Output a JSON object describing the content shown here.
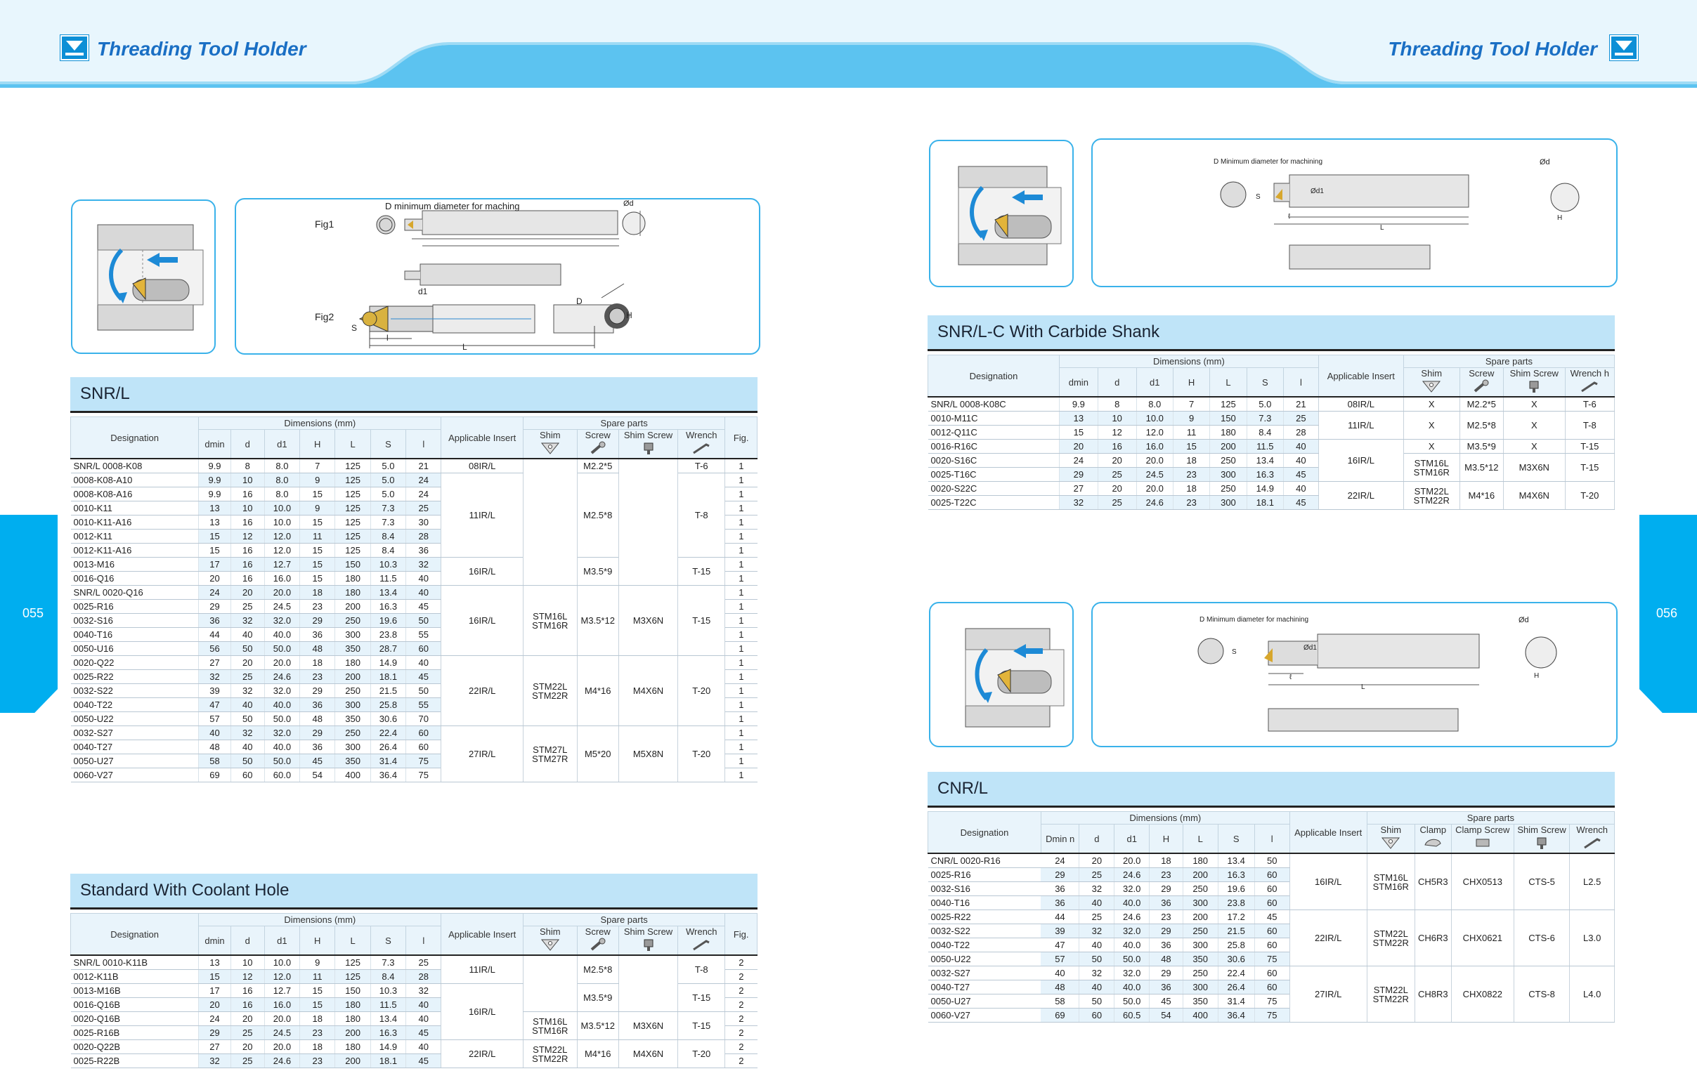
{
  "header": {
    "title_left": "Threading Tool Holder",
    "title_right": "Threading Tool Holder"
  },
  "pages": {
    "left": "055",
    "right": "056"
  },
  "fig1": {
    "fig1_label": "Fig1",
    "fig2_label": "Fig2",
    "min_dia_label": "D minimum diameter for maching",
    "labels": {
      "d": "Ød",
      "H": "H",
      "L": "L",
      "l": "l",
      "S": "S",
      "D": "D",
      "d1": "d1"
    }
  },
  "fig_snrc": {
    "min_dia_label": "D Minimum diameter for machining",
    "labels": {
      "d": "Ød",
      "H": "H",
      "L": "L",
      "l": "ℓ",
      "S": "S",
      "d1": "Ød1"
    }
  },
  "fig_cnr": {
    "min_dia_label": "D Minimum diameter for machining",
    "labels": {
      "d": "Ød",
      "H": "H",
      "L": "L",
      "l": "ℓ",
      "S": "S",
      "d1": "Ød1"
    }
  },
  "sections": {
    "snr": "SNR/L",
    "coolant": "Standard With Coolant Hole",
    "snrc": "SNR/L-C With Carbide Shank",
    "cnr": "CNR/L"
  },
  "head": {
    "designation": "Designation",
    "dimensions": "Dimensions  (mm)",
    "applicable": "Applicable Insert",
    "spare": "Spare parts",
    "dmin": "dmin",
    "d": "d",
    "d1": "d1",
    "H": "H",
    "L": "L",
    "S": "S",
    "l": "l",
    "shim": "Shim",
    "screw": "Screw",
    "shim_screw": "Shim Screw",
    "wrench": "Wrench",
    "fig": "Fig.",
    "wrench_h": "Wrench  h",
    "dmin_n": "Dmin n",
    "clamp": "Clamp",
    "clamp_screw": "Clamp Screw"
  },
  "snr_rows": [
    [
      "SNR/L  0008-K08",
      "9.9",
      "8",
      "8.0",
      "7",
      "125",
      "5.0",
      "21",
      "1"
    ],
    [
      "0008-K08-A10",
      "9.9",
      "10",
      "8.0",
      "9",
      "125",
      "5.0",
      "24",
      "1"
    ],
    [
      "0008-K08-A16",
      "9.9",
      "16",
      "8.0",
      "15",
      "125",
      "5.0",
      "24",
      "1"
    ],
    [
      "0010-K11",
      "13",
      "10",
      "10.0",
      "9",
      "125",
      "7.3",
      "25",
      "1"
    ],
    [
      "0010-K11-A16",
      "13",
      "16",
      "10.0",
      "15",
      "125",
      "7.3",
      "30",
      "1"
    ],
    [
      "0012-K11",
      "15",
      "12",
      "12.0",
      "11",
      "125",
      "8.4",
      "28",
      "1"
    ],
    [
      "0012-K11-A16",
      "15",
      "16",
      "12.0",
      "15",
      "125",
      "8.4",
      "36",
      "1"
    ],
    [
      "0013-M16",
      "17",
      "16",
      "12.7",
      "15",
      "150",
      "10.3",
      "32",
      "1"
    ],
    [
      "0016-Q16",
      "20",
      "16",
      "16.0",
      "15",
      "180",
      "11.5",
      "40",
      "1"
    ],
    [
      "SNR/L  0020-Q16",
      "24",
      "20",
      "20.0",
      "18",
      "180",
      "13.4",
      "40",
      "1"
    ],
    [
      "0025-R16",
      "29",
      "25",
      "24.5",
      "23",
      "200",
      "16.3",
      "45",
      "1"
    ],
    [
      "0032-S16",
      "36",
      "32",
      "32.0",
      "29",
      "250",
      "19.6",
      "50",
      "1"
    ],
    [
      "0040-T16",
      "44",
      "40",
      "40.0",
      "36",
      "300",
      "23.8",
      "55",
      "1"
    ],
    [
      "0050-U16",
      "56",
      "50",
      "50.0",
      "48",
      "350",
      "28.7",
      "60",
      "1"
    ],
    [
      "0020-Q22",
      "27",
      "20",
      "20.0",
      "18",
      "180",
      "14.9",
      "40",
      "1"
    ],
    [
      "0025-R22",
      "32",
      "25",
      "24.6",
      "23",
      "200",
      "18.1",
      "45",
      "1"
    ],
    [
      "0032-S22",
      "39",
      "32",
      "32.0",
      "29",
      "250",
      "21.5",
      "50",
      "1"
    ],
    [
      "0040-T22",
      "47",
      "40",
      "40.0",
      "36",
      "300",
      "25.8",
      "55",
      "1"
    ],
    [
      "0050-U22",
      "57",
      "50",
      "50.0",
      "48",
      "350",
      "30.6",
      "70",
      "1"
    ],
    [
      "0032-S27",
      "40",
      "32",
      "32.0",
      "29",
      "250",
      "22.4",
      "60",
      "1"
    ],
    [
      "0040-T27",
      "48",
      "40",
      "40.0",
      "36",
      "300",
      "26.4",
      "60",
      "1"
    ],
    [
      "0050-U27",
      "58",
      "50",
      "50.0",
      "45",
      "350",
      "31.4",
      "75",
      "1"
    ],
    [
      "0060-V27",
      "69",
      "60",
      "60.0",
      "54",
      "400",
      "36.4",
      "75",
      "1"
    ]
  ],
  "snr_groups": [
    {
      "insert": "08IR/L",
      "shim": "",
      "screw": "M2.2*5",
      "shim_screw": "",
      "wrench": "T-6"
    },
    {
      "insert": "11IR/L",
      "shim": "",
      "screw": "M2.5*8",
      "shim_screw": "",
      "wrench": "T-8"
    },
    {
      "insert": "16IR/L",
      "shim": "",
      "screw": "M3.5*9",
      "shim_screw": "",
      "wrench": "T-15"
    },
    {
      "insert": "16IR/L",
      "shim": "STM16L STM16R",
      "screw": "M3.5*12",
      "shim_screw": "M3X6N",
      "wrench": "T-15"
    },
    {
      "insert": "22IR/L",
      "shim": "STM22L STM22R",
      "screw": "M4*16",
      "shim_screw": "M4X6N",
      "wrench": "T-20"
    },
    {
      "insert": "27IR/L",
      "shim": "STM27L STM27R",
      "screw": "M5*20",
      "shim_screw": "M5X8N",
      "wrench": "T-20"
    }
  ],
  "coolant_rows": [
    [
      "SNR/L  0010-K11B",
      "13",
      "10",
      "10.0",
      "9",
      "125",
      "7.3",
      "25",
      "2"
    ],
    [
      "0012-K11B",
      "15",
      "12",
      "12.0",
      "11",
      "125",
      "8.4",
      "28",
      "2"
    ],
    [
      "0013-M16B",
      "17",
      "16",
      "12.7",
      "15",
      "150",
      "10.3",
      "32",
      "2"
    ],
    [
      "0016-Q16B",
      "20",
      "16",
      "16.0",
      "15",
      "180",
      "11.5",
      "40",
      "2"
    ],
    [
      "0020-Q16B",
      "24",
      "20",
      "20.0",
      "18",
      "180",
      "13.4",
      "40",
      "2"
    ],
    [
      "0025-R16B",
      "29",
      "25",
      "24.5",
      "23",
      "200",
      "16.3",
      "45",
      "2"
    ],
    [
      "0020-Q22B",
      "27",
      "20",
      "20.0",
      "18",
      "180",
      "14.9",
      "40",
      "2"
    ],
    [
      "0025-R22B",
      "32",
      "25",
      "24.6",
      "23",
      "200",
      "18.1",
      "45",
      "2"
    ]
  ],
  "coolant_groups": [
    {
      "insert": "11IR/L",
      "shim": "",
      "screw": "M2.5*8",
      "shim_screw": "",
      "wrench": "T-8"
    },
    {
      "insert": "16IR/L",
      "shim": "",
      "screw": "M3.5*9",
      "shim_screw": "",
      "wrench": "T-15"
    },
    {
      "insert": "",
      "shim": "STM16L STM16R",
      "screw": "M3.5*12",
      "shim_screw": "M3X6N",
      "wrench": "T-15"
    },
    {
      "insert": "22IR/L",
      "shim": "STM22L STM22R",
      "screw": "M4*16",
      "shim_screw": "M4X6N",
      "wrench": "T-20"
    }
  ],
  "snrc_rows": [
    [
      "SNR/L  0008-K08C",
      "9.9",
      "8",
      "8.0",
      "7",
      "125",
      "5.0",
      "21"
    ],
    [
      "0010-M11C",
      "13",
      "10",
      "10.0",
      "9",
      "150",
      "7.3",
      "25"
    ],
    [
      "0012-Q11C",
      "15",
      "12",
      "12.0",
      "11",
      "180",
      "8.4",
      "28"
    ],
    [
      "0016-R16C",
      "20",
      "16",
      "16.0",
      "15",
      "200",
      "11.5",
      "40"
    ],
    [
      "0020-S16C",
      "24",
      "20",
      "20.0",
      "18",
      "250",
      "13.4",
      "40"
    ],
    [
      "0025-T16C",
      "29",
      "25",
      "24.5",
      "23",
      "300",
      "16.3",
      "45"
    ],
    [
      "0020-S22C",
      "27",
      "20",
      "20.0",
      "18",
      "250",
      "14.9",
      "40"
    ],
    [
      "0025-T22C",
      "32",
      "25",
      "24.6",
      "23",
      "300",
      "18.1",
      "45"
    ]
  ],
  "snrc_groups": [
    {
      "insert": "08IR/L",
      "shim": "X",
      "screw": "M2.2*5",
      "shim_screw": "X",
      "wrench": "T-6"
    },
    {
      "insert": "11IR/L",
      "shim": "X",
      "screw": "M2.5*8",
      "shim_screw": "X",
      "wrench": "T-8"
    },
    {
      "insert": "16IR/L",
      "shim": "X",
      "screw": "M3.5*9",
      "shim_screw": "X",
      "wrench": "T-15"
    },
    {
      "insert": "",
      "shim": "STM16L STM16R",
      "screw": "M3.5*12",
      "shim_screw": "M3X6N",
      "wrench": "T-15"
    },
    {
      "insert": "22IR/L",
      "shim": "STM22L STM22R",
      "screw": "M4*16",
      "shim_screw": "M4X6N",
      "wrench": "T-20"
    }
  ],
  "cnr_rows": [
    [
      "CNR/L  0020-R16",
      "24",
      "20",
      "20.0",
      "18",
      "180",
      "13.4",
      "50"
    ],
    [
      "0025-R16",
      "29",
      "25",
      "24.6",
      "23",
      "200",
      "16.3",
      "60"
    ],
    [
      "0032-S16",
      "36",
      "32",
      "32.0",
      "29",
      "250",
      "19.6",
      "60"
    ],
    [
      "0040-T16",
      "36",
      "40",
      "40.0",
      "36",
      "300",
      "23.8",
      "60"
    ],
    [
      "0025-R22",
      "44",
      "25",
      "24.6",
      "23",
      "200",
      "17.2",
      "45"
    ],
    [
      "0032-S22",
      "39",
      "32",
      "32.0",
      "29",
      "250",
      "21.5",
      "60"
    ],
    [
      "0040-T22",
      "47",
      "40",
      "40.0",
      "36",
      "300",
      "25.8",
      "60"
    ],
    [
      "0050-U22",
      "57",
      "50",
      "50.0",
      "48",
      "350",
      "30.6",
      "75"
    ],
    [
      "0032-S27",
      "40",
      "32",
      "32.0",
      "29",
      "250",
      "22.4",
      "60"
    ],
    [
      "0040-T27",
      "48",
      "40",
      "40.0",
      "36",
      "300",
      "26.4",
      "60"
    ],
    [
      "0050-U27",
      "58",
      "50",
      "50.0",
      "45",
      "350",
      "31.4",
      "75"
    ],
    [
      "0060-V27",
      "69",
      "60",
      "60.5",
      "54",
      "400",
      "36.4",
      "75"
    ]
  ],
  "cnr_groups": [
    {
      "insert": "16IR/L",
      "shim": "STM16L STM16R",
      "clamp": "CH5R3",
      "clamp_screw": "CHX0513",
      "shim_screw": "CTS-5",
      "wrench": "L2.5"
    },
    {
      "insert": "22IR/L",
      "shim": "STM22L STM22R",
      "clamp": "CH6R3",
      "clamp_screw": "CHX0621",
      "shim_screw": "CTS-6",
      "wrench": "L3.0"
    },
    {
      "insert": "27IR/L",
      "shim": "STM22L STM22R",
      "clamp": "CH8R3",
      "clamp_screw": "CHX0822",
      "shim_screw": "CTS-8",
      "wrench": "L4.0"
    }
  ],
  "colors": {
    "accent": "#00aeef",
    "title": "#1a6fc4",
    "section_bg": "#bfe4f8",
    "header_bg": "#e6f5fd"
  }
}
